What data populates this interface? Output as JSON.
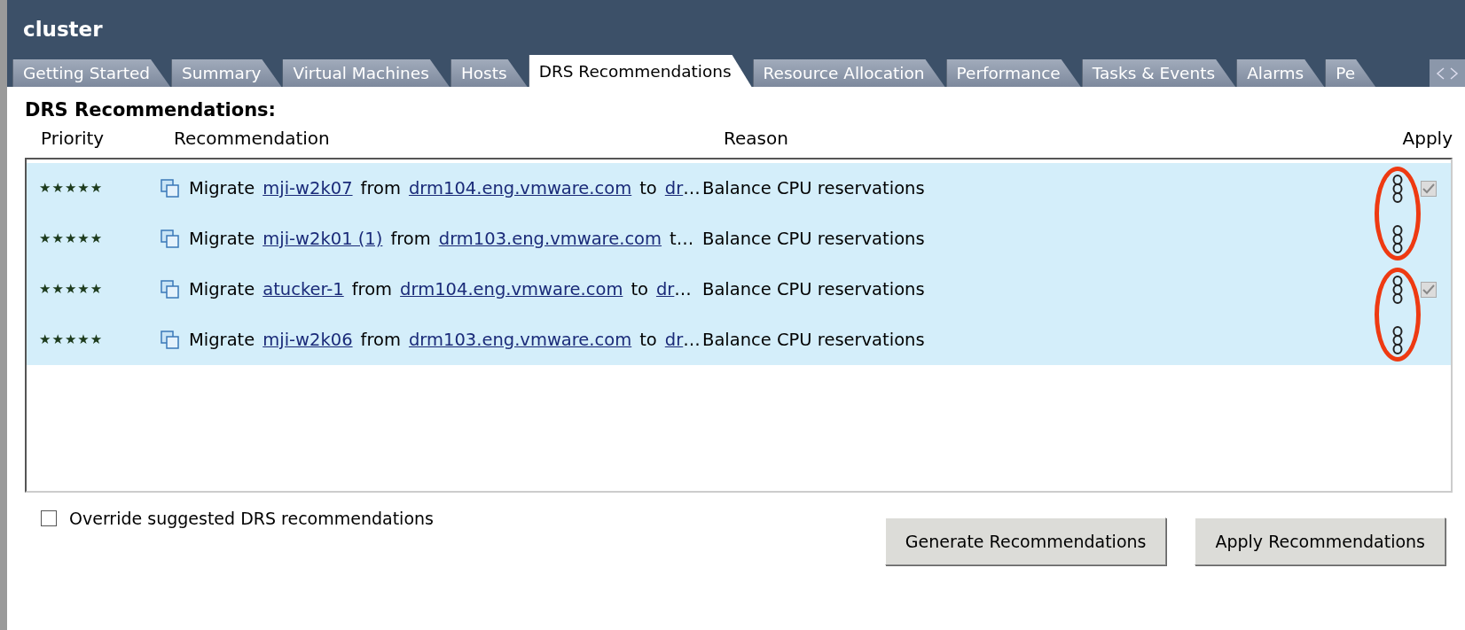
{
  "window": {
    "title": "cluster"
  },
  "tabs": [
    {
      "label": "Getting Started",
      "selected": false
    },
    {
      "label": "Summary",
      "selected": false
    },
    {
      "label": "Virtual Machines",
      "selected": false
    },
    {
      "label": "Hosts",
      "selected": false
    },
    {
      "label": "DRS Recommendations",
      "selected": true
    },
    {
      "label": "Resource Allocation",
      "selected": false
    },
    {
      "label": "Performance",
      "selected": false
    },
    {
      "label": "Tasks & Events",
      "selected": false
    },
    {
      "label": "Alarms",
      "selected": false
    },
    {
      "label": "Pe",
      "selected": false
    }
  ],
  "section_title": "DRS Recommendations:",
  "columns": [
    "Priority",
    "Recommendation",
    "Reason",
    "Apply"
  ],
  "rows": [
    {
      "stars": 5,
      "segments": [
        {
          "text": "Migrate",
          "link": false
        },
        {
          "text": "mji-w2k07",
          "link": true
        },
        {
          "text": "from",
          "link": false
        },
        {
          "text": "drm104.eng.vmware.com",
          "link": true
        },
        {
          "text": "to",
          "link": false
        },
        {
          "text": "dr",
          "link": true
        },
        {
          "text": "…",
          "link": false,
          "attached": true
        }
      ],
      "reason": "Balance CPU reservations",
      "checkbox": true,
      "checked": true
    },
    {
      "stars": 5,
      "segments": [
        {
          "text": "Migrate",
          "link": false
        },
        {
          "text": "mji-w2k01 (1)",
          "link": true
        },
        {
          "text": "from",
          "link": false
        },
        {
          "text": "drm103.eng.vmware.com",
          "link": true
        },
        {
          "text": "t…",
          "link": false
        }
      ],
      "reason": "Balance CPU reservations",
      "checkbox": false
    },
    {
      "stars": 5,
      "segments": [
        {
          "text": "Migrate",
          "link": false
        },
        {
          "text": "atucker-1",
          "link": true
        },
        {
          "text": "from",
          "link": false
        },
        {
          "text": "drm104.eng.vmware.com",
          "link": true
        },
        {
          "text": "to",
          "link": false
        },
        {
          "text": "dr",
          "link": true
        },
        {
          "text": "…",
          "link": false,
          "attached": true
        }
      ],
      "reason": "Balance CPU reservations",
      "checkbox": true,
      "checked": true
    },
    {
      "stars": 5,
      "segments": [
        {
          "text": "Migrate",
          "link": false
        },
        {
          "text": "mji-w2k06",
          "link": true
        },
        {
          "text": "from",
          "link": false
        },
        {
          "text": "drm103.eng.vmware.com",
          "link": true
        },
        {
          "text": "to",
          "link": false
        },
        {
          "text": "dr",
          "link": true
        },
        {
          "text": "…",
          "link": false,
          "attached": true
        }
      ],
      "reason": "Balance CPU reservations",
      "checkbox": false
    }
  ],
  "annotations": [
    {
      "kind": "ellipse"
    },
    {
      "kind": "ellipse"
    }
  ],
  "override": {
    "label": "Override suggested DRS recommendations",
    "checked": false
  },
  "buttons": [
    "Generate Recommendations",
    "Apply Recommendations"
  ]
}
